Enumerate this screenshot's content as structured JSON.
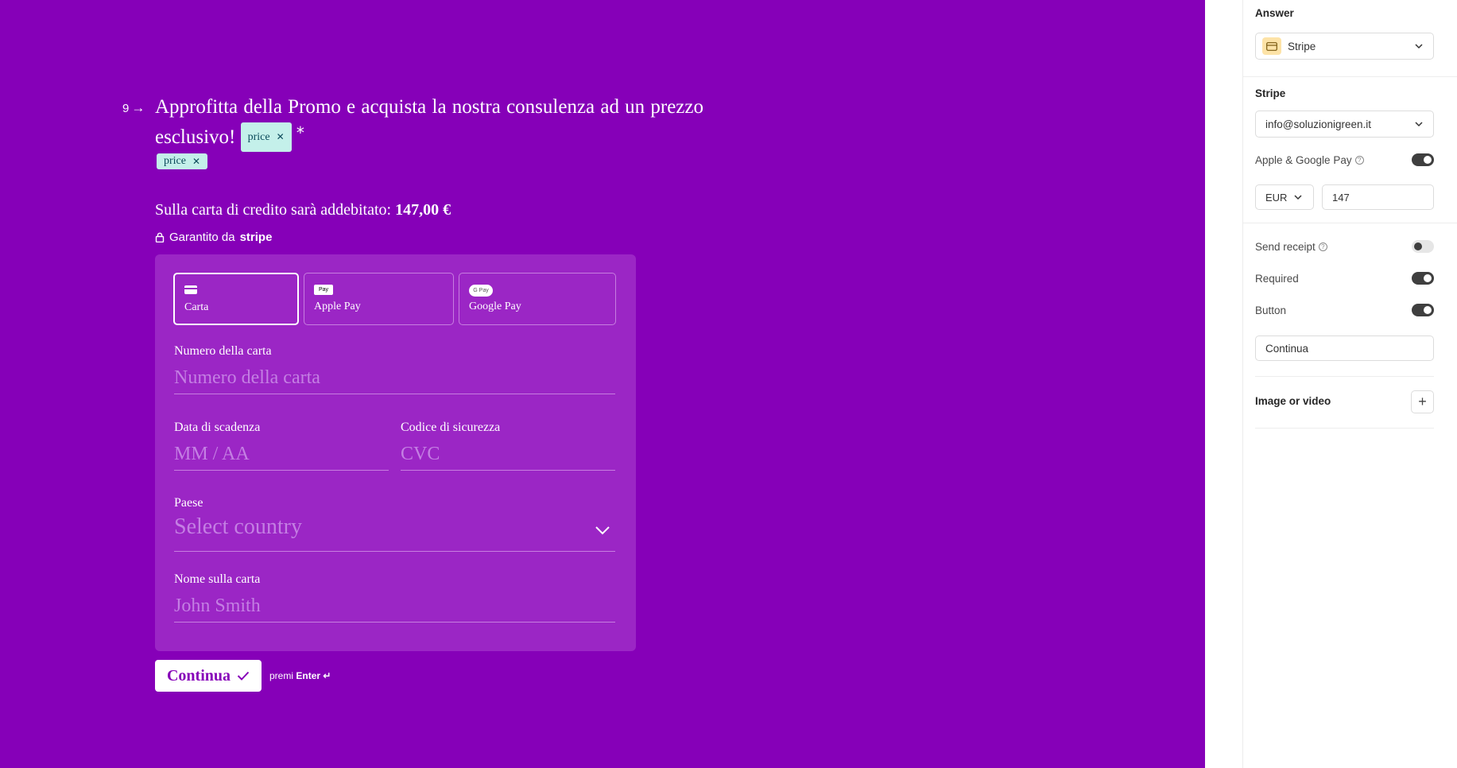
{
  "form": {
    "question_number": "9",
    "question_title": "Approfitta della Promo e acquista la nostra consulenza ad un prezzo esclusivo!",
    "tag_label": "price",
    "required_mark": "*",
    "charge_prefix": "Sulla carta di credito sarà addebitato:",
    "charge_amount": "147,00 €",
    "guarantee_prefix": "Garantito da",
    "guarantee_brand": "stripe",
    "methods": [
      {
        "label": "Carta",
        "icon": "credit-card-icon",
        "active": true
      },
      {
        "label": "Apple Pay",
        "icon": "apple-pay-icon",
        "icon_text": "Pay"
      },
      {
        "label": "Google Pay",
        "icon": "google-pay-icon",
        "icon_text": "G Pay"
      }
    ],
    "card_number": {
      "label": "Numero della carta",
      "placeholder": "Numero della carta"
    },
    "expiry": {
      "label": "Data di scadenza",
      "placeholder": "MM / AA"
    },
    "cvc": {
      "label": "Codice di sicurezza",
      "placeholder": "CVC"
    },
    "country": {
      "label": "Paese",
      "placeholder": "Select country"
    },
    "cardholder": {
      "label": "Nome sulla carta",
      "placeholder": "John Smith"
    },
    "submit_label": "Continua",
    "hint_prefix": "premi",
    "hint_key": "Enter ↵"
  },
  "panel": {
    "answer_heading": "Answer",
    "answer_type": "Stripe",
    "stripe_heading": "Stripe",
    "stripe_account": "info@soluzionigreen.it",
    "apple_google_pay": {
      "label": "Apple & Google Pay",
      "on": true
    },
    "currency": "EUR",
    "amount": "147",
    "send_receipt": {
      "label": "Send receipt",
      "on": false
    },
    "required": {
      "label": "Required",
      "on": true
    },
    "button": {
      "label": "Button",
      "on": true
    },
    "button_text": "Continua",
    "image_or_video": "Image or video"
  },
  "colors": {
    "canvas_background": "#8600b8",
    "form_box": "#9b26c5",
    "tag_background": "#c4f0ea"
  }
}
